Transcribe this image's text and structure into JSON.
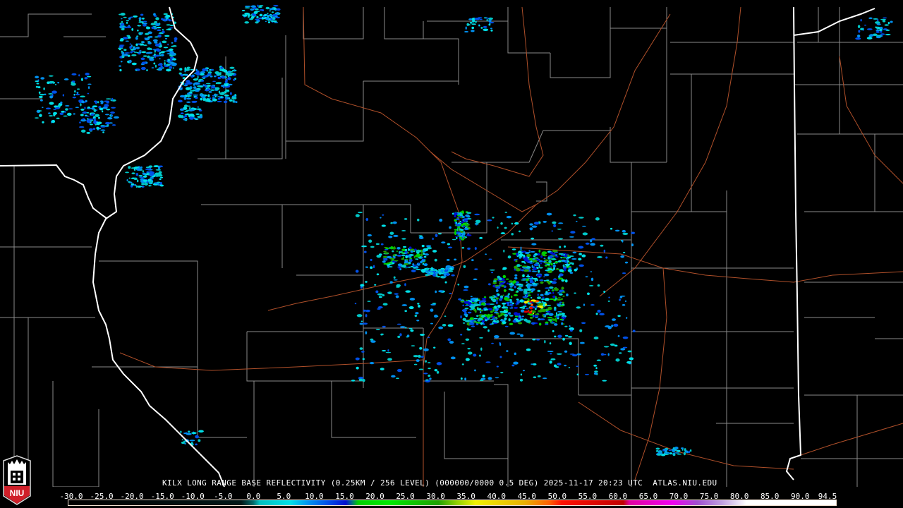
{
  "product": {
    "caption": "KILX LONG RANGE BASE REFLECTIVITY (0.25KM / 256 LEVEL) (000000/0000 0.5 DEG) 2025-11-17 20:23 UTC  ATLAS.NIU.EDU"
  },
  "logo": {
    "text": "NIU"
  },
  "colorbar": {
    "labels": [
      "-30.0",
      "-25.0",
      "-20.0",
      "-15.0",
      "-10.0",
      "-5.0",
      "0.0",
      "5.0",
      "10.0",
      "15.0",
      "20.0",
      "25.0",
      "30.0",
      "35.0",
      "40.0",
      "45.0",
      "50.0",
      "55.0",
      "60.0",
      "65.0",
      "70.0",
      "75.0",
      "80.0",
      "85.0",
      "90.0",
      "94.5"
    ],
    "min": -30,
    "max": 94.5,
    "stops": [
      {
        "v": -30,
        "c": "#000000"
      },
      {
        "v": -2,
        "c": "#001818"
      },
      {
        "v": 0,
        "c": "#006b6b"
      },
      {
        "v": 1,
        "c": "#00c0c0"
      },
      {
        "v": 6,
        "c": "#00e0e8"
      },
      {
        "v": 9,
        "c": "#0090f0"
      },
      {
        "v": 12,
        "c": "#0050e8"
      },
      {
        "v": 15,
        "c": "#0010d0"
      },
      {
        "v": 16,
        "c": "#007080"
      },
      {
        "v": 17,
        "c": "#00d000"
      },
      {
        "v": 22,
        "c": "#00e800"
      },
      {
        "v": 30,
        "c": "#20a000"
      },
      {
        "v": 33,
        "c": "#90d000"
      },
      {
        "v": 36,
        "c": "#f0f000"
      },
      {
        "v": 44,
        "c": "#e8b000"
      },
      {
        "v": 48,
        "c": "#ff6000"
      },
      {
        "v": 50,
        "c": "#ff1000"
      },
      {
        "v": 60,
        "c": "#c00000"
      },
      {
        "v": 61,
        "c": "#e000a0"
      },
      {
        "v": 68,
        "c": "#f000f0"
      },
      {
        "v": 72,
        "c": "#a050d0"
      },
      {
        "v": 76,
        "c": "#c0a0e0"
      },
      {
        "v": 80,
        "c": "#ffffff"
      },
      {
        "v": 94.5,
        "c": "#ffffff"
      }
    ]
  },
  "colors": {
    "state_border": "#ffffff",
    "county_border": "#8a8a8a",
    "highway": "#b0502a",
    "logo_red": "#d0202a"
  }
}
